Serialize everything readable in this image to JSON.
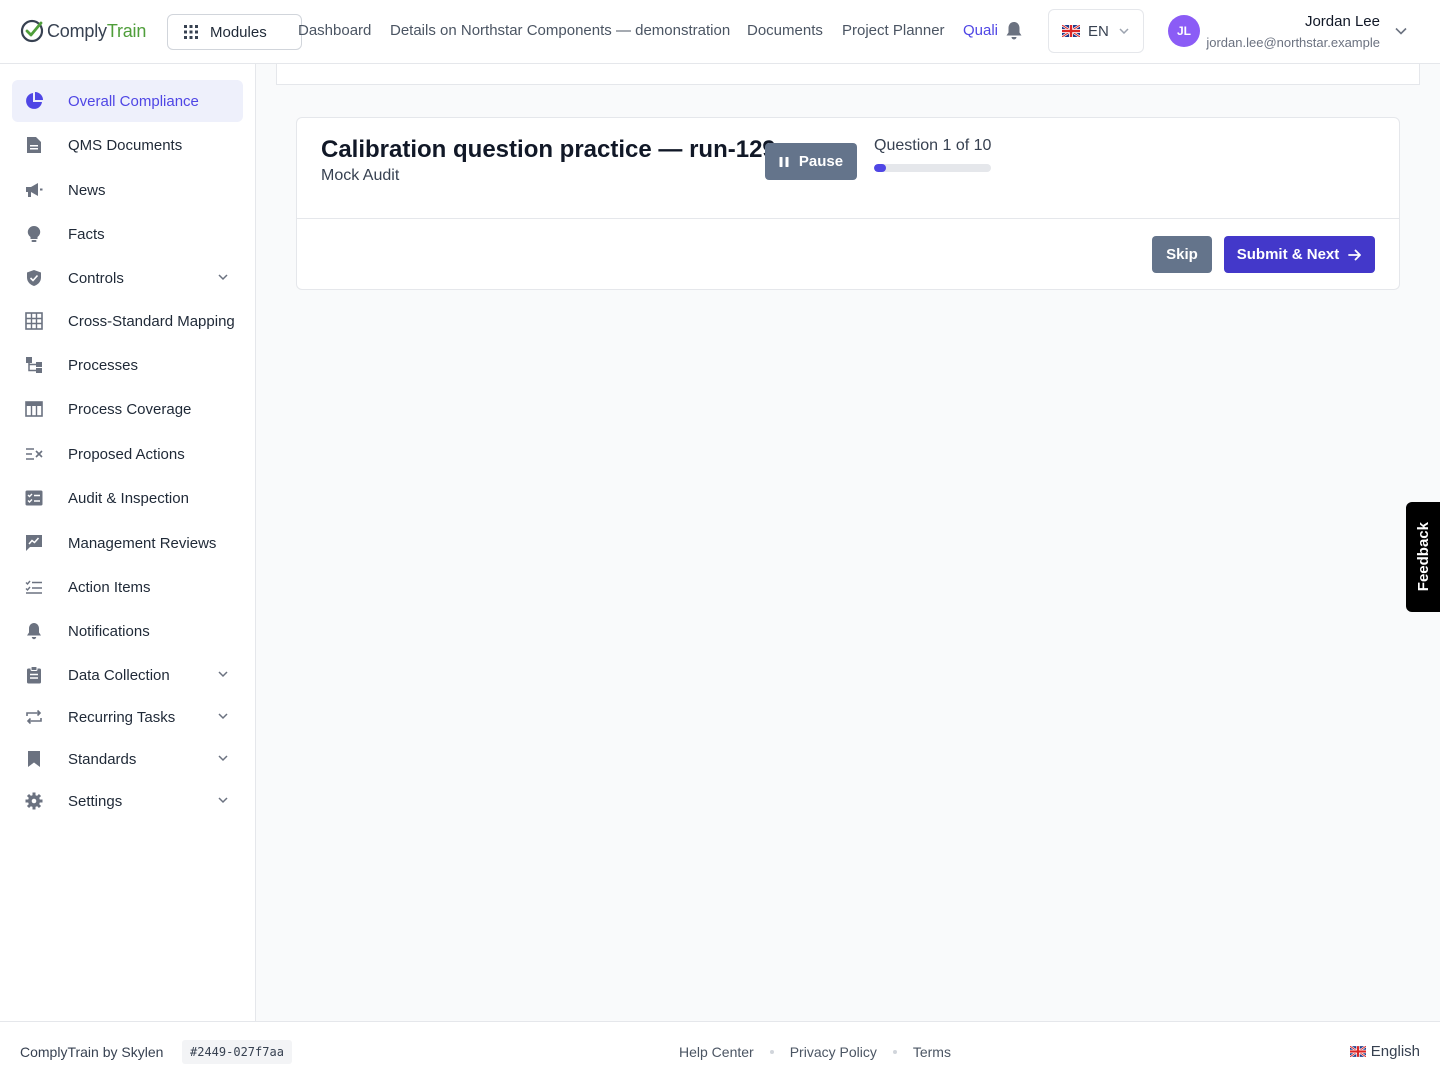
{
  "app": {
    "logo_part1": "Comply",
    "logo_part2": "Train",
    "brand_color": "#4f9e3a",
    "accent": "#4f46e5"
  },
  "header": {
    "modules_label": "Modules",
    "nav": [
      "Dashboard",
      "Details on Northstar Components — demonstration",
      "Documents",
      "Project Planner",
      "Quali"
    ],
    "active_nav": "Quali",
    "language": "EN",
    "language_flag": "uk-flag-icon",
    "user": {
      "initials": "JL",
      "name": "Jordan Lee",
      "email": "jordan.lee@northstar.example"
    }
  },
  "sidebar": {
    "items": [
      {
        "label": "Overall Compliance",
        "icon": "pie-chart-icon",
        "active": true
      },
      {
        "label": "QMS Documents",
        "icon": "document-icon"
      },
      {
        "label": "News",
        "icon": "megaphone-icon"
      },
      {
        "label": "Facts",
        "icon": "lightbulb-icon"
      },
      {
        "label": "Controls",
        "icon": "shield-icon",
        "expandable": true
      },
      {
        "label": "Cross-Standard Mapping",
        "icon": "grid-table-icon"
      },
      {
        "label": "Processes",
        "icon": "flow-icon"
      },
      {
        "label": "Process Coverage",
        "icon": "table-icon"
      },
      {
        "label": "Proposed Actions",
        "icon": "list-x-icon"
      },
      {
        "label": "Audit & Inspection",
        "icon": "checklist-icon"
      },
      {
        "label": "Management Reviews",
        "icon": "review-icon"
      },
      {
        "label": "Action Items",
        "icon": "list-check-icon"
      },
      {
        "label": "Notifications",
        "icon": "bell-icon"
      },
      {
        "label": "Data Collection",
        "icon": "clipboard-icon",
        "expandable": true
      },
      {
        "label": "Recurring Tasks",
        "icon": "repeat-icon",
        "expandable": true
      },
      {
        "label": "Standards",
        "icon": "bookmark-icon",
        "expandable": true
      },
      {
        "label": "Settings",
        "icon": "gear-icon",
        "expandable": true
      }
    ]
  },
  "quiz": {
    "title": "Calibration question practice — run-129",
    "subtitle": "Mock Audit",
    "pause_label": "Pause",
    "counter": "Question 1 of 10",
    "progress_fraction": 0.1,
    "skip_label": "Skip",
    "submit_label": "Submit & Next"
  },
  "feedback_label": "Feedback",
  "footer": {
    "brand": "ComplyTrain by Skylen",
    "build": "#2449-027f7aa",
    "links": [
      "Help Center",
      "Privacy Policy",
      "Terms"
    ],
    "language": "English"
  }
}
